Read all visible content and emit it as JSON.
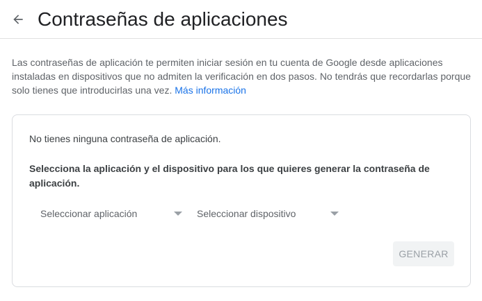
{
  "header": {
    "back_icon": "arrow-back-icon",
    "title": "Contraseñas de aplicaciones"
  },
  "intro": {
    "text": "Las contraseñas de aplicación te permiten iniciar sesión en tu cuenta de Google desde aplicaciones instaladas en dispositivos que no admiten la verificación en dos pasos. No tendrás que recordarlas porque solo tienes que introducirlas una vez.",
    "link_label": "Más información"
  },
  "card": {
    "empty_message": "No tienes ninguna contraseña de aplicación.",
    "instruction": "Selecciona la aplicación y el dispositivo para los que quieres generar la contraseña de aplicación.",
    "app_select": {
      "value": "Seleccionar aplicación",
      "icon": "dropdown-caret-icon"
    },
    "device_select": {
      "value": "Seleccionar dispositivo",
      "icon": "dropdown-caret-icon"
    },
    "generate_label": "GENERAR"
  },
  "colors": {
    "link": "#1a73e8",
    "text_primary": "#202124",
    "text_secondary": "#5f6368",
    "border": "#dadce0",
    "button_disabled_bg": "#f1f3f4",
    "button_disabled_text": "#9aa0a6"
  }
}
